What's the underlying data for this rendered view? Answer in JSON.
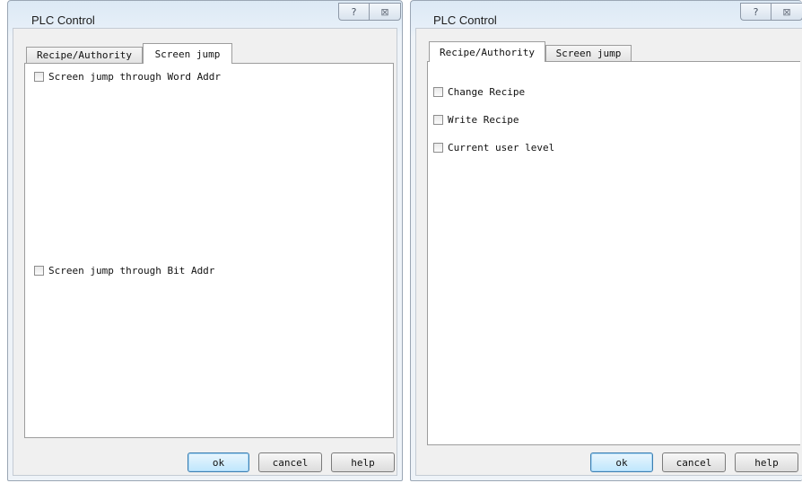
{
  "left_dialog": {
    "title": "PLC Control",
    "caption": {
      "help_glyph": "?",
      "close_glyph": "⊠"
    },
    "tabs": [
      {
        "label": "Recipe/Authority",
        "active": false
      },
      {
        "label": "Screen jump",
        "active": true
      }
    ],
    "checkboxes": [
      {
        "label": "Screen jump through Word Addr",
        "checked": false
      },
      {
        "label": "Screen jump through Bit Addr",
        "checked": false
      }
    ],
    "buttons": {
      "ok": "ok",
      "cancel": "cancel",
      "help": "help"
    }
  },
  "right_dialog": {
    "title": "PLC Control",
    "caption": {
      "help_glyph": "?",
      "close_glyph": "⊠"
    },
    "tabs": [
      {
        "label": "Recipe/Authority",
        "active": true
      },
      {
        "label": "Screen jump",
        "active": false
      }
    ],
    "checkboxes": [
      {
        "label": "Change Recipe",
        "checked": false
      },
      {
        "label": "Write Recipe",
        "checked": false
      },
      {
        "label": "Current user level",
        "checked": false
      }
    ],
    "buttons": {
      "ok": "ok",
      "cancel": "cancel",
      "help": "help"
    }
  }
}
